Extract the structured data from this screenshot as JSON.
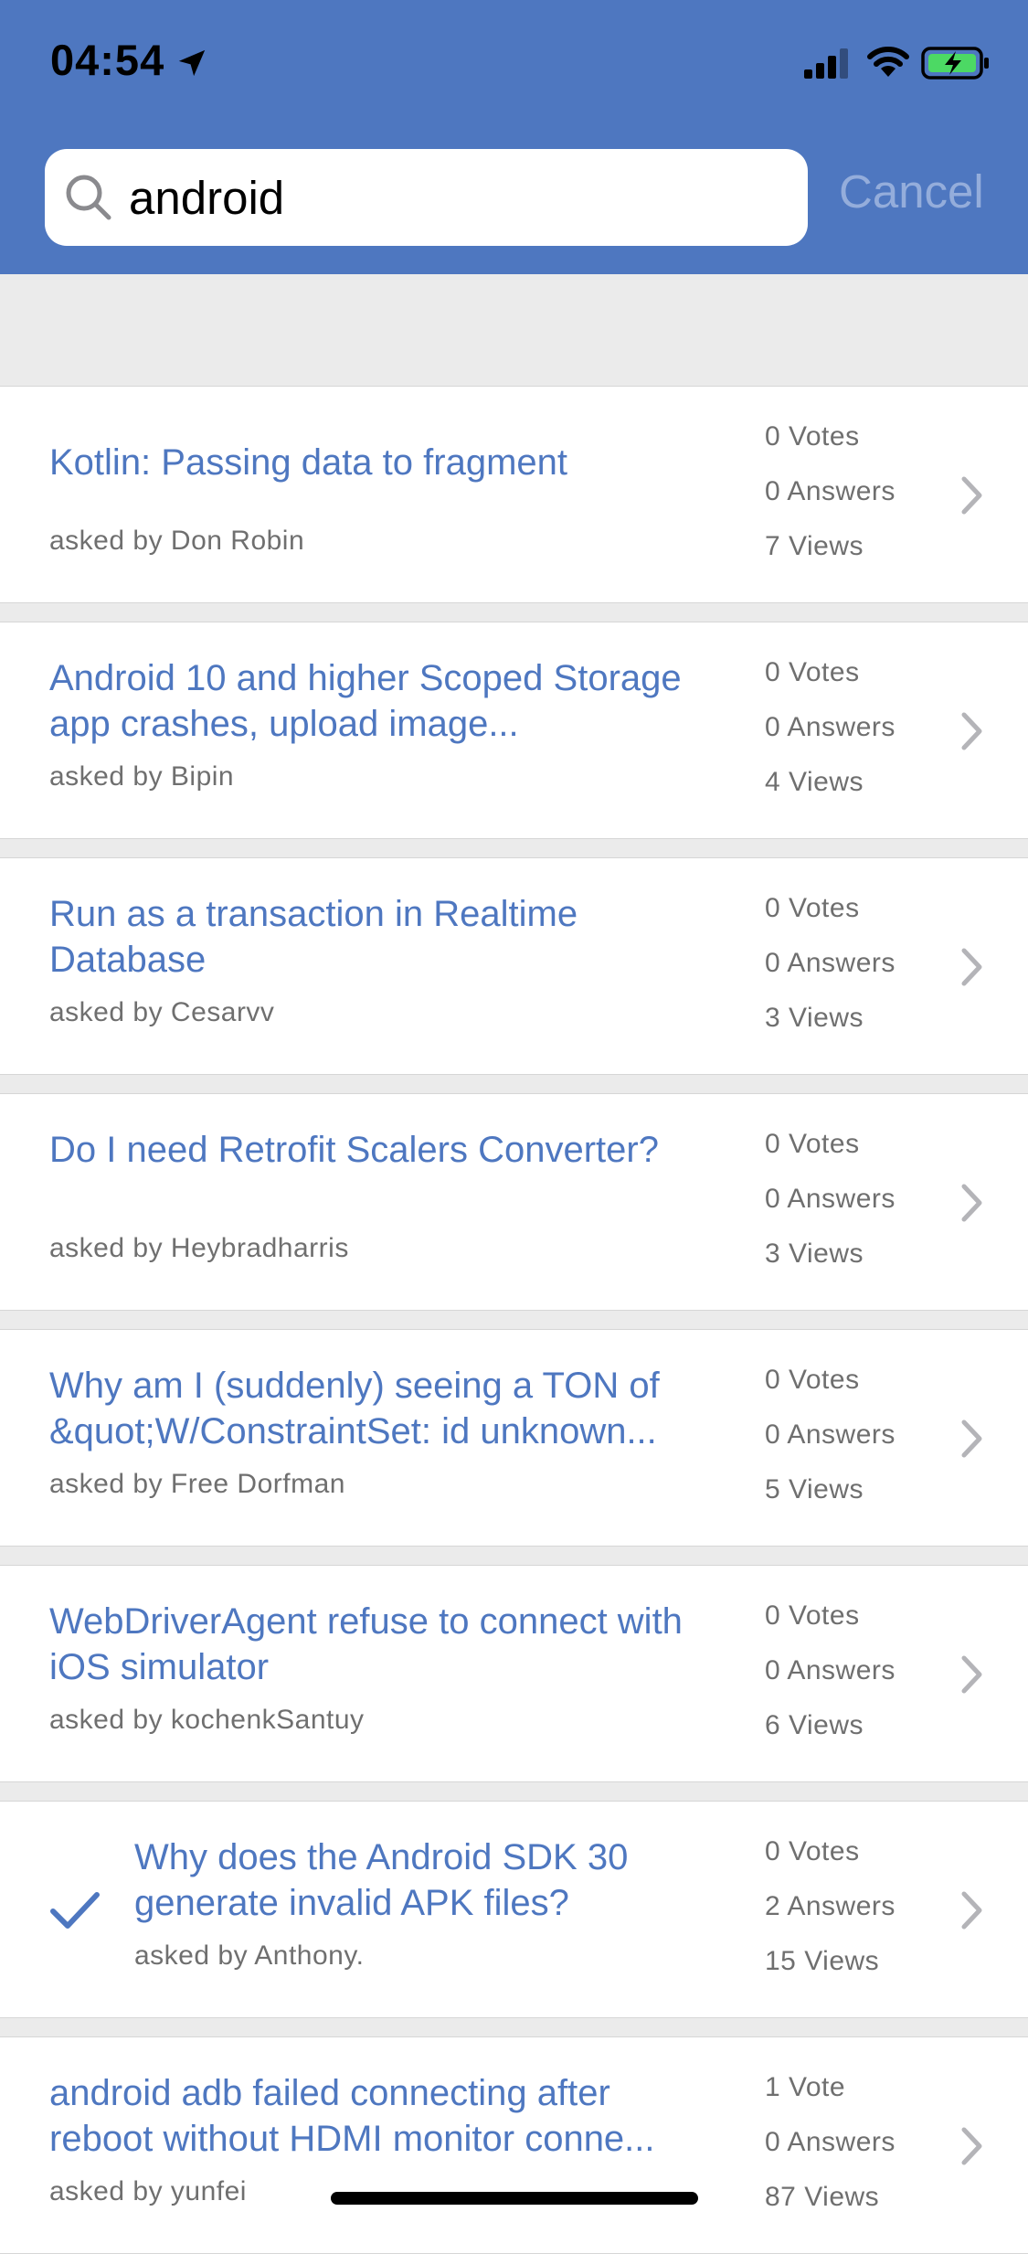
{
  "status_bar": {
    "time": "04:54"
  },
  "search": {
    "value": "android",
    "cancel_label": "Cancel"
  },
  "results": [
    {
      "title": "Kotlin: Passing data to fragment",
      "asker": "asked by Don Robin",
      "votes": "0 Votes",
      "answers": "0 Answers",
      "views": "7 Views",
      "accepted": false
    },
    {
      "title": "Android 10 and higher Scoped Storage app crashes, upload image...",
      "asker": "asked by Bipin",
      "votes": "0 Votes",
      "answers": "0 Answers",
      "views": "4 Views",
      "accepted": false
    },
    {
      "title": "Run as a transaction in Realtime Database",
      "asker": "asked by Cesarvv",
      "votes": "0 Votes",
      "answers": "0 Answers",
      "views": "3 Views",
      "accepted": false
    },
    {
      "title": "Do I need Retrofit Scalers Converter?",
      "asker": "asked by Heybradharris",
      "votes": "0 Votes",
      "answers": "0 Answers",
      "views": "3 Views",
      "accepted": false
    },
    {
      "title": "Why am I (suddenly) seeing a TON of &quot;W/ConstraintSet: id unknown...",
      "asker": "asked by Free Dorfman",
      "votes": "0 Votes",
      "answers": "0 Answers",
      "views": "5 Views",
      "accepted": false
    },
    {
      "title": "WebDriverAgent refuse to connect with iOS simulator",
      "asker": "asked by kochenkSantuy",
      "votes": "0 Votes",
      "answers": "0 Answers",
      "views": "6 Views",
      "accepted": false
    },
    {
      "title": "Why does the Android SDK 30 generate invalid APK files?",
      "asker": "asked by Anthony.",
      "votes": "0 Votes",
      "answers": "2 Answers",
      "views": "15 Views",
      "accepted": true
    },
    {
      "title": "android adb failed connecting after reboot without HDMI monitor conne...",
      "asker": "asked by yunfei",
      "votes": "1 Vote",
      "answers": "0 Answers",
      "views": "87 Views",
      "accepted": false
    }
  ],
  "colors": {
    "header": "#4e77c0",
    "link": "#4e77c0",
    "cancel": "#94addb",
    "meta": "#6f6f6f"
  },
  "icons": [
    "location-arrow-icon",
    "cellular-signal-icon",
    "wifi-icon",
    "battery-charging-icon",
    "search-icon",
    "chevron-right-icon",
    "checkmark-icon"
  ]
}
